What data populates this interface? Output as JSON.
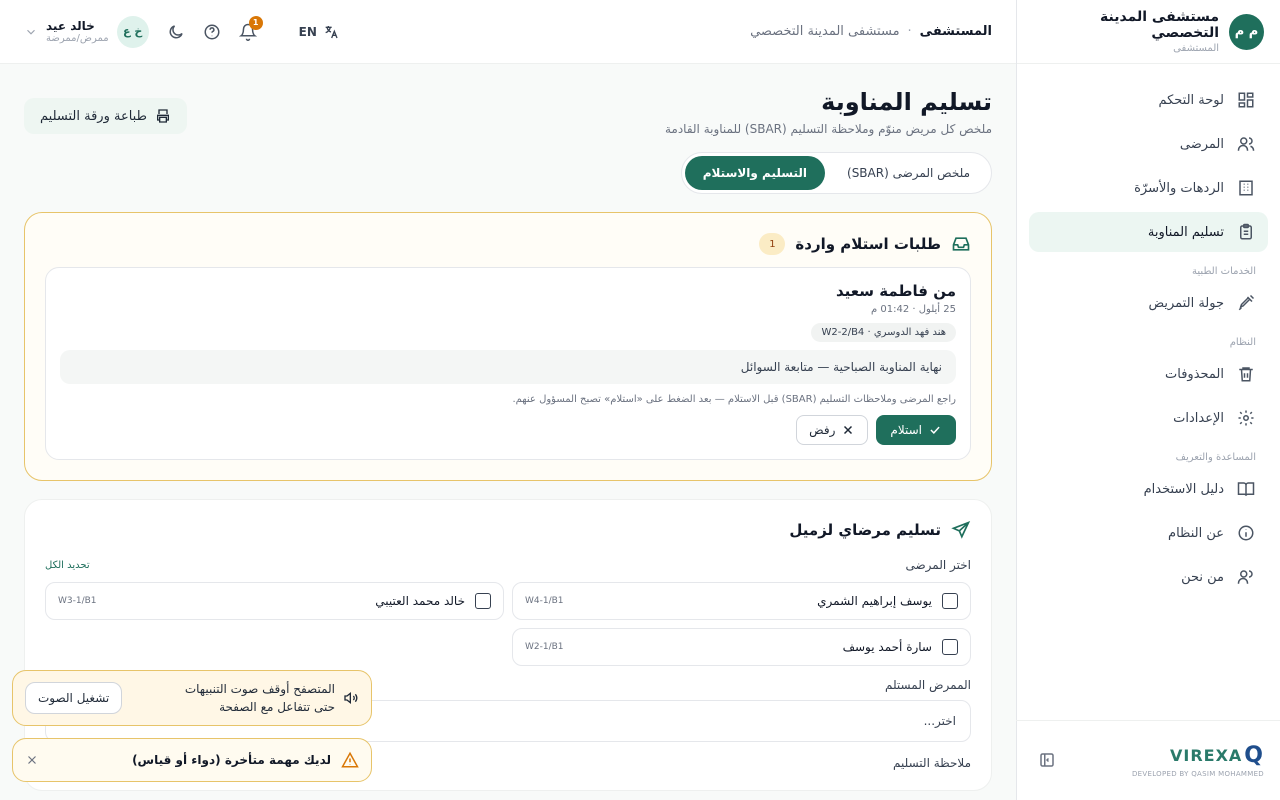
{
  "sidebar": {
    "logo_initials": "م م",
    "brand_title": "مستشفى المدينة التخصصي",
    "brand_sub": "المستشفى",
    "items": [
      {
        "label": "لوحة التحكم",
        "icon": "dashboard-icon"
      },
      {
        "label": "المرضى",
        "icon": "users-icon"
      },
      {
        "label": "الردهات والأسرّة",
        "icon": "building-icon"
      },
      {
        "label": "تسليم المناوبة",
        "icon": "clipboard-icon"
      }
    ],
    "section_medical": "الخدمات الطبية",
    "item_rounds": "جولة التمريض",
    "section_system": "النظام",
    "item_deleted": "المحذوفات",
    "item_settings": "الإعدادات",
    "section_help": "المساعدة والتعريف",
    "item_guide": "دليل الاستخدام",
    "item_about": "عن النظام",
    "item_us": "من نحن",
    "footer_brand": "VIREXA",
    "footer_sub": "DEVELOPED BY QASIM MOHAMMED"
  },
  "topbar": {
    "breadcrumb_current": "المستشفى",
    "breadcrumb_link": "مستشفى المدينة التخصصي",
    "lang": "EN",
    "notif_count": "1",
    "user_initials": "خ ع",
    "user_name": "خالد عيد",
    "user_role": "ممرض/ممرضة"
  },
  "page": {
    "title": "تسليم المناوبة",
    "subtitle": "ملخص كل مريض منوّم وملاحظة التسليم (SBAR) للمناوبة القادمة",
    "print_label": "طباعة ورقة التسليم",
    "tabs": [
      "التسليم والاستلام",
      "ملخص المرضى (SBAR)"
    ]
  },
  "incoming": {
    "title": "طلبات استلام واردة",
    "count": "1",
    "from": "من فاطمة سعيد",
    "time": "25 أيلول · 01:42 م",
    "chip": "هند فهد الدوسري · W2-2/B4",
    "note": "نهاية المناوبة الصباحية — متابعة السوائل",
    "hint": "راجع المرضى وملاحظات التسليم (SBAR) قبل الاستلام — بعد الضغط على «استلام» تصبح المسؤول عنهم.",
    "accept": "استلام",
    "reject": "رفض"
  },
  "handover": {
    "title": "تسليم مرضاي لزميل",
    "choose_label": "اختر المرضى",
    "select_all": "تحديد الكل",
    "patients": [
      {
        "name": "يوسف إبراهيم الشمري",
        "bed": "W4-1/B1"
      },
      {
        "name": "خالد محمد العتيبي",
        "bed": "W3-1/B1"
      },
      {
        "name": "سارة أحمد يوسف",
        "bed": "W2-1/B1"
      }
    ],
    "receiver_label": "الممرض المستلم",
    "receiver_placeholder": "اختر...",
    "note_label": "ملاحظة التسليم"
  },
  "toasts": {
    "sound_line1": "المتصفح أوقف صوت التنبيهات",
    "sound_line2": "حتى تتفاعل مع الصفحة",
    "sound_button": "تشغيل الصوت",
    "warn_text": "لديك مهمة متأخرة (دواء أو قياس)"
  },
  "colors": {
    "primary": "#1f6f5c",
    "warning": "#d97706",
    "incoming_border": "#e7c46a"
  }
}
